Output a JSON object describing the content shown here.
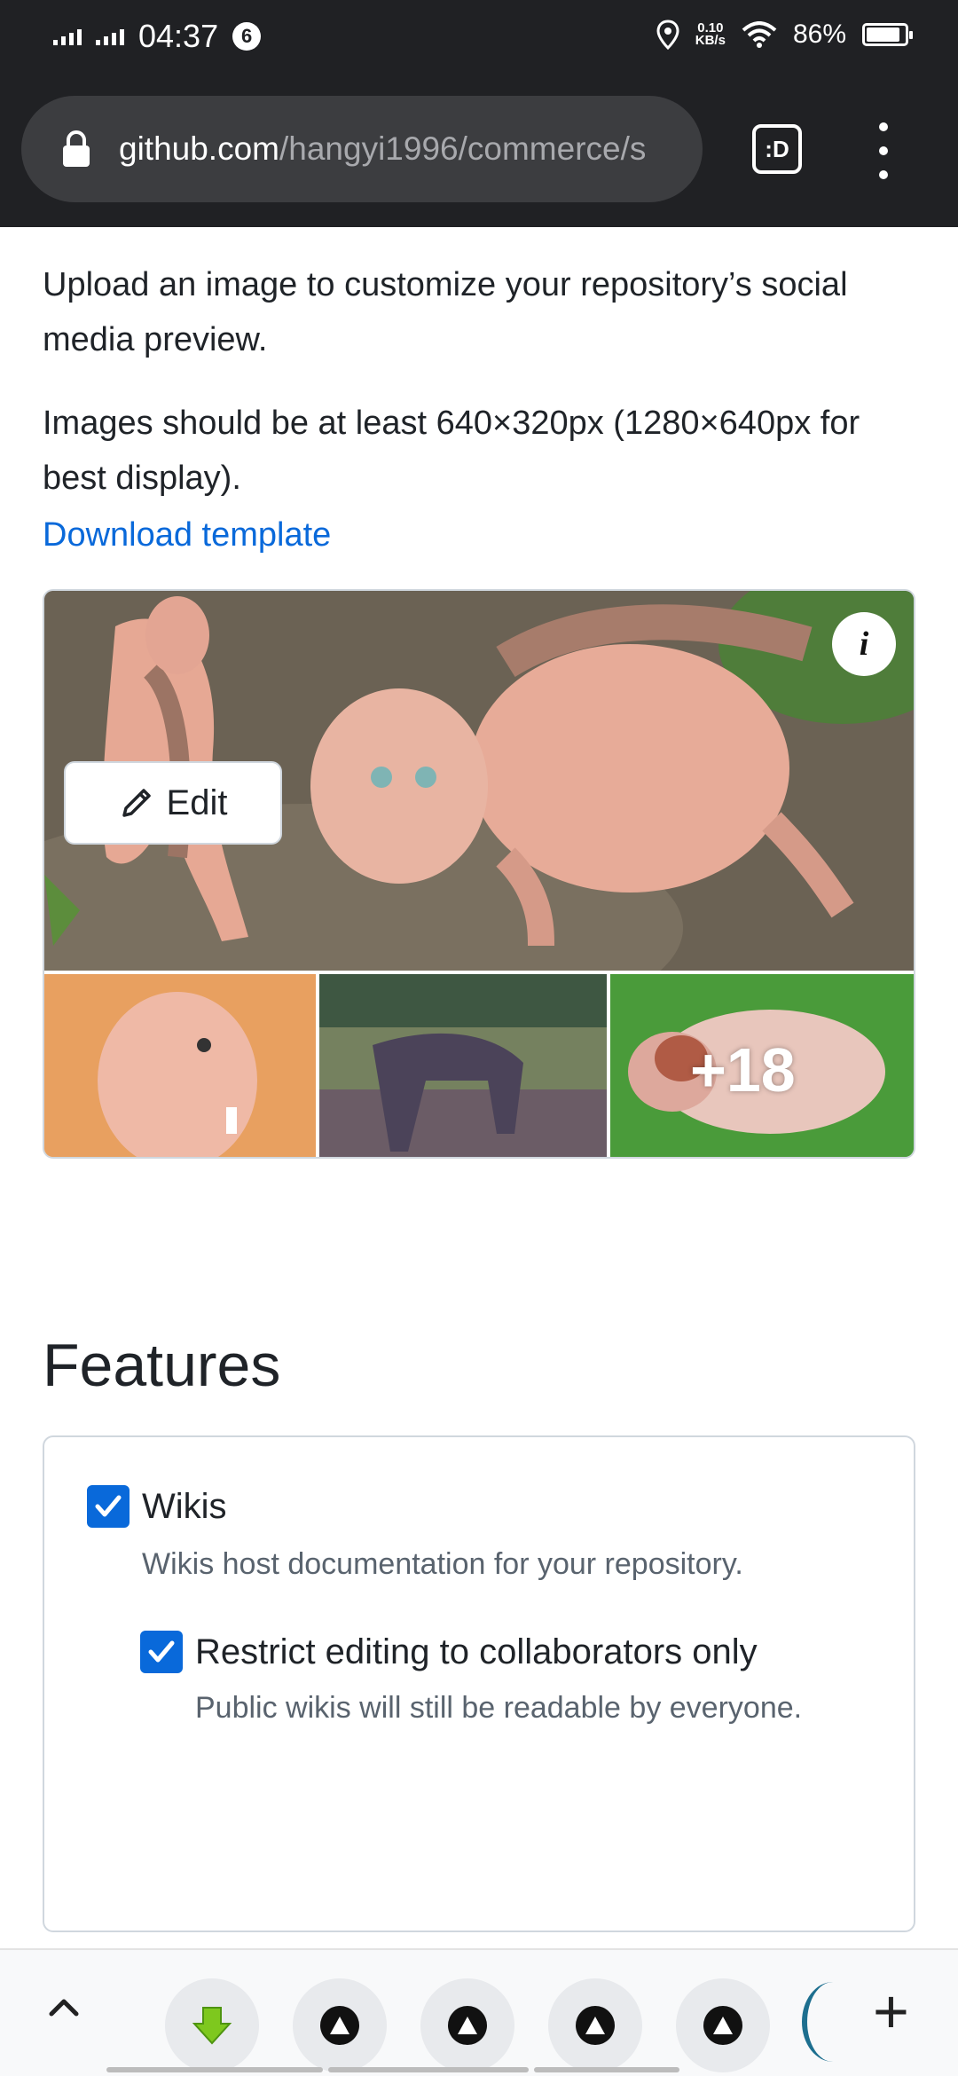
{
  "status_bar": {
    "time": "04:37",
    "notification_count": "6",
    "net_speed_value": "0.10",
    "net_speed_unit": "KB/s",
    "battery": "86%"
  },
  "browser": {
    "url_host": "github.com",
    "url_path": "/hangyi1996/commerce/s",
    "tabs_label": ":D"
  },
  "social_preview": {
    "intro": "Upload an image to customize your repository’s social media preview.",
    "size_hint": "Images should be at least 640×320px (1280×640px for best display).",
    "download_link": "Download template",
    "more_count": "+18",
    "edit_label": "Edit",
    "info_label": "i"
  },
  "features": {
    "title": "Features",
    "wikis_label": "Wikis",
    "wikis_desc": "Wikis host documentation for your repository.",
    "restrict_label": "Restrict editing to collaborators only",
    "restrict_desc": "Public wikis will still be readable by everyone."
  },
  "colors": {
    "link": "#0969da",
    "checkbox": "#0969da",
    "browser_chrome": "#202124"
  }
}
